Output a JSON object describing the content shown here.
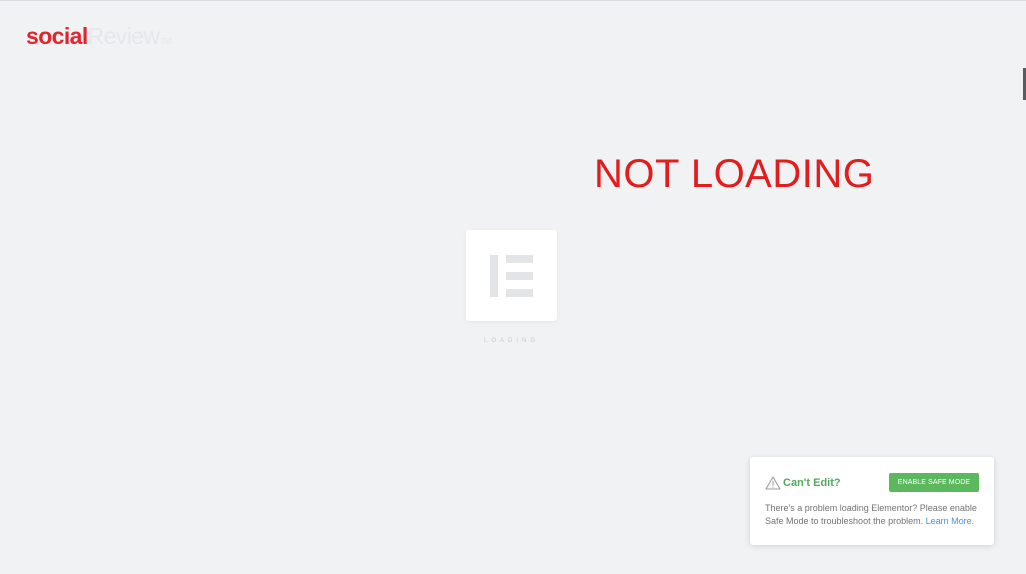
{
  "logo": {
    "part1": "social",
    "part2": "Review",
    "tm": "TM"
  },
  "annotation": {
    "text": "NOT LOADING"
  },
  "loader": {
    "icon": "elementor-logo-icon",
    "label": "LOADING"
  },
  "dialog": {
    "icon": "warning-icon",
    "title": "Can't Edit?",
    "button_label": "ENABLE SAFE MODE",
    "message": "There's a problem loading Elementor? Please enable Safe Mode to troubleshoot the problem.",
    "link_label": "Learn More."
  },
  "colors": {
    "background": "#f1f2f4",
    "brand_red": "#e2242c",
    "annotation_red": "#e31c1c",
    "safe_mode_green": "#5cb85c",
    "title_green": "#55a860",
    "link_blue": "#4a90d9"
  }
}
